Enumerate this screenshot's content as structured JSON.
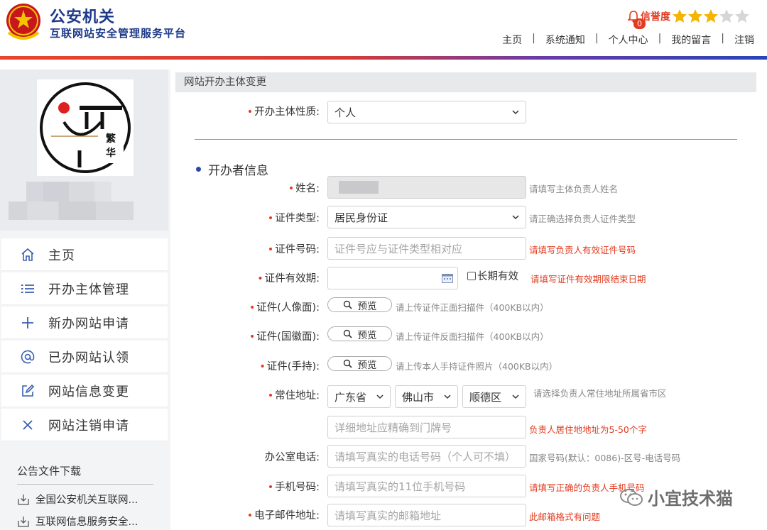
{
  "header": {
    "title": "公安机关",
    "subtitle": "互联网站安全管理服务平台",
    "credit_label": "信誉度",
    "badge_count": "0",
    "stars_filled": 3,
    "stars_total": 5,
    "nav": [
      "主页",
      "系统通知",
      "个人中心",
      "我的留言",
      "注销"
    ]
  },
  "colors": {
    "brand": "#1d3a8a",
    "accent_red": "#e23b1f",
    "star_gold": "#f5b400",
    "menu_icon": "#3a5fb0"
  },
  "sidebar": {
    "menu": [
      {
        "label": "主页",
        "icon": "home-icon"
      },
      {
        "label": "开办主体管理",
        "icon": "list-icon"
      },
      {
        "label": "新办网站申请",
        "icon": "plus-icon"
      },
      {
        "label": "已办网站认领",
        "icon": "at-icon"
      },
      {
        "label": "网站信息变更",
        "icon": "edit-icon"
      },
      {
        "label": "网站注销申请",
        "icon": "close-icon"
      }
    ],
    "downloads_title": "公告文件下载",
    "downloads": [
      "全国公安机关互联网...",
      "互联网信息服务安全..."
    ]
  },
  "panel": {
    "title": "网站开办主体变更"
  },
  "form": {
    "subject_type": {
      "label": "开办主体性质:",
      "value": "个人"
    },
    "section_title": "开办者信息",
    "name": {
      "label": "姓名:",
      "hint": "请填写主体负责人姓名"
    },
    "id_type": {
      "label": "证件类型:",
      "value": "居民身份证",
      "hint": "请正确选择负责人证件类型"
    },
    "id_number": {
      "label": "证件号码:",
      "placeholder": "证件号应与证件类型相对应",
      "error": "请填写负责人有效证件号码"
    },
    "id_validity": {
      "label": "证件有效期:",
      "checkbox_label": "长期有效",
      "error": "请填写证件有效期限结束日期"
    },
    "id_front": {
      "label": "证件(人像面):",
      "button": "预览",
      "hint": "请上传证件正面扫描件（400KB以内）"
    },
    "id_back": {
      "label": "证件(国徽面):",
      "button": "预览",
      "hint": "请上传证件反面扫描件（400KB以内）"
    },
    "id_hand": {
      "label": "证件(手持):",
      "button": "预览",
      "hint": "请上传本人手持证件照片（400KB以内）"
    },
    "address": {
      "label": "常住地址:",
      "province": "广东省",
      "city": "佛山市",
      "district": "顺德区",
      "hint": "请选择负责人常住地址所属省市区",
      "detail_placeholder": "详细地址应精确到门牌号",
      "detail_error": "负责人居住地地址为5-50个字"
    },
    "office_phone": {
      "label": "办公室电话:",
      "placeholder": "请填写真实的电话号码（个人可不填）",
      "hint": "国家号码(默认：0086)-区号-电话号码"
    },
    "mobile": {
      "label": "手机号码:",
      "placeholder": "请填写真实的11位手机号码",
      "error": "请填写正确的负责人手机号码"
    },
    "email": {
      "label": "电子邮件地址:",
      "placeholder": "请填写真实的邮箱地址",
      "error": "此邮箱格式有问题"
    }
  },
  "watermark": "小宜技术猫"
}
